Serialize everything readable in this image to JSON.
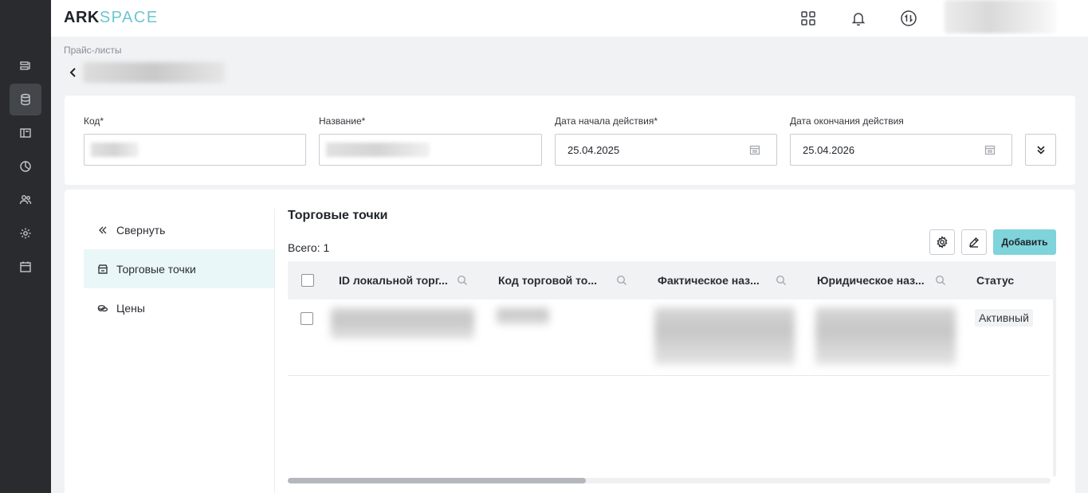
{
  "app": {
    "logo_part1": "ARK",
    "logo_part2": "SPACE"
  },
  "header": {
    "icons": [
      "apps-grid-icon",
      "bell-icon",
      "sync-icon"
    ]
  },
  "breadcrumb": "Прайс-листы",
  "form": {
    "code_label": "Код*",
    "name_label": "Название*",
    "start_label": "Дата начала действия*",
    "start_value": "25.04.2025",
    "end_label": "Дата окончания действия",
    "end_value": "25.04.2026"
  },
  "side_nav": {
    "collapse": "Свернуть",
    "items": [
      {
        "label": "Торговые точки",
        "icon": "store-icon",
        "active": true
      },
      {
        "label": "Цены",
        "icon": "coins-icon",
        "active": false
      }
    ]
  },
  "section": {
    "title": "Торговые точки",
    "total": "Всего: 1",
    "add_button": "Добавить"
  },
  "table": {
    "columns": [
      "ID локальной торг...",
      "Код торговой то...",
      "Фактическое наз...",
      "Юридическое наз...",
      "Статус"
    ],
    "rows": [
      {
        "status": "Активный"
      }
    ]
  },
  "colors": {
    "accent": "#7fd3db",
    "rail": "#292b2f",
    "active_nav": "#eaf7f8"
  }
}
